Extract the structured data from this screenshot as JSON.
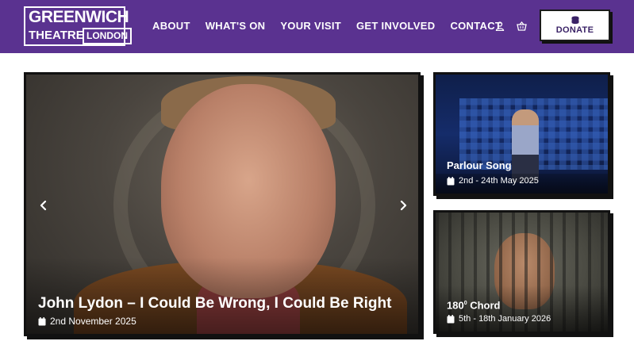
{
  "header": {
    "logo": {
      "line1": "GREENWICH",
      "line2": "THEATRE",
      "box": "LONDON"
    },
    "nav": [
      "ABOUT",
      "WHAT'S ON",
      "YOUR VISIT",
      "GET INVOLVED",
      "CONTACT"
    ],
    "donate_label": "DONATE",
    "icons": [
      "user-icon",
      "basket-icon",
      "coins-icon"
    ]
  },
  "colors": {
    "brand": "#5a3290",
    "text_on_brand": "#ffffff",
    "card_border": "#111111"
  },
  "hero": {
    "title": "John Lydon – I Could Be Wrong, I Could Be Right",
    "date": "2nd November 2025"
  },
  "side_cards": [
    {
      "title": "Parlour Song",
      "date": "2nd - 24th May 2025"
    },
    {
      "title_main": "180",
      "title_sup": "0",
      "title_rest": " Chord",
      "date": "5th - 18th January 2026"
    }
  ]
}
